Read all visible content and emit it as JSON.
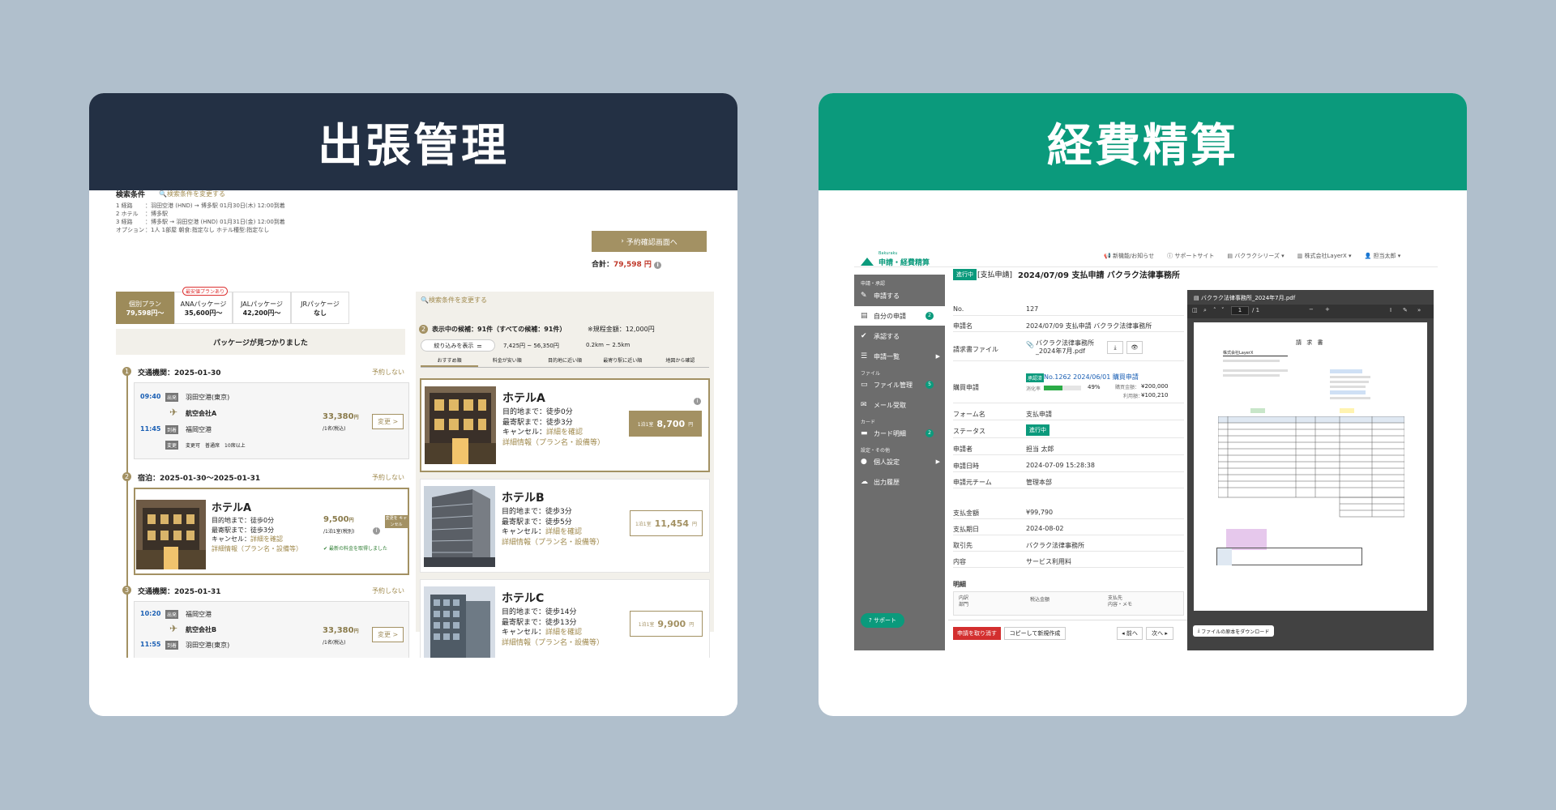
{
  "left": {
    "header_title": "出張管理",
    "search_conditions_label": "検索条件",
    "change_search_link": "検索条件を変更する",
    "conditions": [
      {
        "label": "1 経路",
        "value": "：羽田空港 (HND) → 博多駅 01月30日(木) 12:00到着"
      },
      {
        "label": "2 ホテル",
        "value": "：博多駅"
      },
      {
        "label": "3 経路",
        "value": "：博多駅 → 羽田空港 (HND) 01月31日(金) 12:00到着"
      },
      {
        "label": "オプション",
        "value": "：1人 1部屋 朝食:指定なし ホテル種型:指定なし"
      }
    ],
    "confirm_button": "予約確認画面へ",
    "total_label": "合計：",
    "total_value": "79,598 円",
    "tabs": [
      {
        "name": "個別プラン",
        "price": "79,598円〜",
        "active": true
      },
      {
        "name": "ANAパッケージ",
        "price": "35,600円〜",
        "badge": "最安値プランあり"
      },
      {
        "name": "JALパッケージ",
        "price": "42,200円〜"
      },
      {
        "name": "JRパッケージ",
        "price": "なし"
      }
    ],
    "no_package_message": "パッケージが見つかりました",
    "steps": [
      {
        "num": "1",
        "title": "交通機関：2025-01-30",
        "action": "予約しない"
      },
      {
        "num": "2",
        "title": "宿泊：2025-01-30〜2025-01-31",
        "action": "予約しない"
      },
      {
        "num": "3",
        "title": "交通機関：2025-01-31",
        "action": "予約しない"
      }
    ],
    "flight1": {
      "dep_time": "09:40",
      "dep_tag": "出発",
      "dep_place": "羽田空港(東京)",
      "airline": "航空会社A",
      "arr_time": "11:45",
      "arr_tag": "到着",
      "arr_place": "福岡空港",
      "note_tag": "変更",
      "note": "変更可　普通席　10席以上",
      "price": "33,380",
      "yen": "円",
      "per": "/1名(税込)",
      "change": "変更 >"
    },
    "stay": {
      "name": "ホテルA",
      "d1": "目的地まで：徒歩0分",
      "d2": "最寄駅まで：徒歩3分",
      "d3": "キャンセル：",
      "d3link": "詳細を確認",
      "d4": "詳細情報（プラン名・設備等）",
      "price": "9,500",
      "yen": "円",
      "per": "/1泊1室(税別)",
      "cancel_btn": "変更を キャンセル",
      "refresh": "最新の料金を取得しました"
    },
    "flight2": {
      "dep_time": "10:20",
      "dep_tag": "出発",
      "dep_place": "福岡空港",
      "airline": "航空会社B",
      "arr_time": "11:55",
      "arr_tag": "到着",
      "arr_place": "羽田空港(東京)",
      "price": "33,380",
      "yen": "円",
      "per": "/1名(税込)",
      "change": "変更 >"
    },
    "right_panel": {
      "change_link": "検索条件を変更する",
      "count_text": "表示中の候補：91件（すべての候補：91件）",
      "limit_text": "※規程金額：12,000円",
      "filter_button": "絞り込みを表示",
      "range_price": "7,425円 ~ 56,350円",
      "range_dist": "0.2km ~ 2.5km",
      "sorts": [
        "おすすめ順",
        "料金が安い順",
        "目的地に近い順",
        "最寄り駅に近い順",
        "地図から確認"
      ],
      "hotels": [
        {
          "name": "ホテルA",
          "d1": "目的地まで：徒歩0分",
          "d2": "最寄駅まで：徒歩3分",
          "d3": "キャンセル：",
          "d3link": "詳細を確認",
          "d4": "詳細情報（プラン名・設備等）",
          "unit": "1泊1室",
          "price": "8,700",
          "yen": "円"
        },
        {
          "name": "ホテルB",
          "d1": "目的地まで：徒歩3分",
          "d2": "最寄駅まで：徒歩5分",
          "d3": "キャンセル：",
          "d3link": "詳細を確認",
          "d4": "詳細情報（プラン名・設備等）",
          "unit": "1泊1室",
          "price": "11,454",
          "yen": "円"
        },
        {
          "name": "ホテルC",
          "d1": "目的地まで：徒歩14分",
          "d2": "最寄駅まで：徒歩13分",
          "d3": "キャンセル：",
          "d3link": "詳細を確認",
          "d4": "詳細情報（プラン名・設備等）",
          "unit": "1泊1室",
          "price": "9,900",
          "yen": "円"
        }
      ]
    }
  },
  "right": {
    "header_title": "経費精算",
    "logo_small": "Bakuraku",
    "logo_main": "申請・経費精算",
    "topbar": [
      "新機能/お知らせ",
      "サポートサイト",
      "バクラクシリーズ",
      "株式会社LayerX",
      "担当太郎"
    ],
    "status_tag": "進行中",
    "doc_type": "[支払申請]",
    "doc_title": "2024/07/09 支払申請 バクラク法律事務所",
    "sidebar": {
      "sec1": "申請・承認",
      "items1": [
        "申請する",
        "自分の申請",
        "承認する",
        "申請一覧"
      ],
      "sec2": "ファイル",
      "items2": [
        "ファイル管理",
        "メール受取"
      ],
      "sec3": "カード",
      "items3": [
        "カード明細"
      ],
      "sec4": "設定・その他",
      "items4": [
        "個人設定",
        "出力履歴"
      ],
      "badge_mine": "2",
      "badge_file": "5",
      "badge_card": "2",
      "support": "サポート"
    },
    "fields": [
      {
        "label": "No.",
        "value": "127"
      },
      {
        "label": "申請名",
        "value": "2024/07/09 支払申請 バクラク法律事務所"
      },
      {
        "label": "請求書ファイル",
        "value": "バクラク法律事務所_2024年7月.pdf"
      },
      {
        "label": "購買申請",
        "value": "No.1262 2024/06/01 購買申請"
      },
      {
        "label": "フォーム名",
        "value": "支払申請"
      },
      {
        "label": "ステータス",
        "value": "進行中"
      },
      {
        "label": "申請者",
        "value": "担当 太郎"
      },
      {
        "label": "申請日時",
        "value": "2024-07-09 15:28:38"
      },
      {
        "label": "申請元チーム",
        "value": "管理本部"
      },
      {
        "label": "支払金額",
        "value": "¥99,790"
      },
      {
        "label": "支払期日",
        "value": "2024-08-02"
      },
      {
        "label": "取引先",
        "value": "バクラク法律事務所"
      },
      {
        "label": "内容",
        "value": "サービス利用料"
      }
    ],
    "purchase": {
      "tag": "承認済",
      "rate_label": "消化率",
      "rate": "49%",
      "amount_label": "購買金額：",
      "amount": "¥200,000",
      "used_label": "利用額：",
      "used": "¥100,210",
      "progress": 0.49
    },
    "detail_label": "明細",
    "detail_cols": [
      "内訳",
      "部門",
      "税込金額",
      "支払先",
      "内容・メモ"
    ],
    "actions": {
      "withdraw": "申請を取り消す",
      "copy": "コピーして新規作成",
      "prev": "前へ",
      "next": "次へ"
    },
    "pdf": {
      "filename": "バクラク法律事務所_2024年7月.pdf",
      "page": "1",
      "pages": "/ 1",
      "doc_title": "請 求 書",
      "company": "株式会社LayerX",
      "download": "ファイルの原本をダウンロード"
    }
  }
}
